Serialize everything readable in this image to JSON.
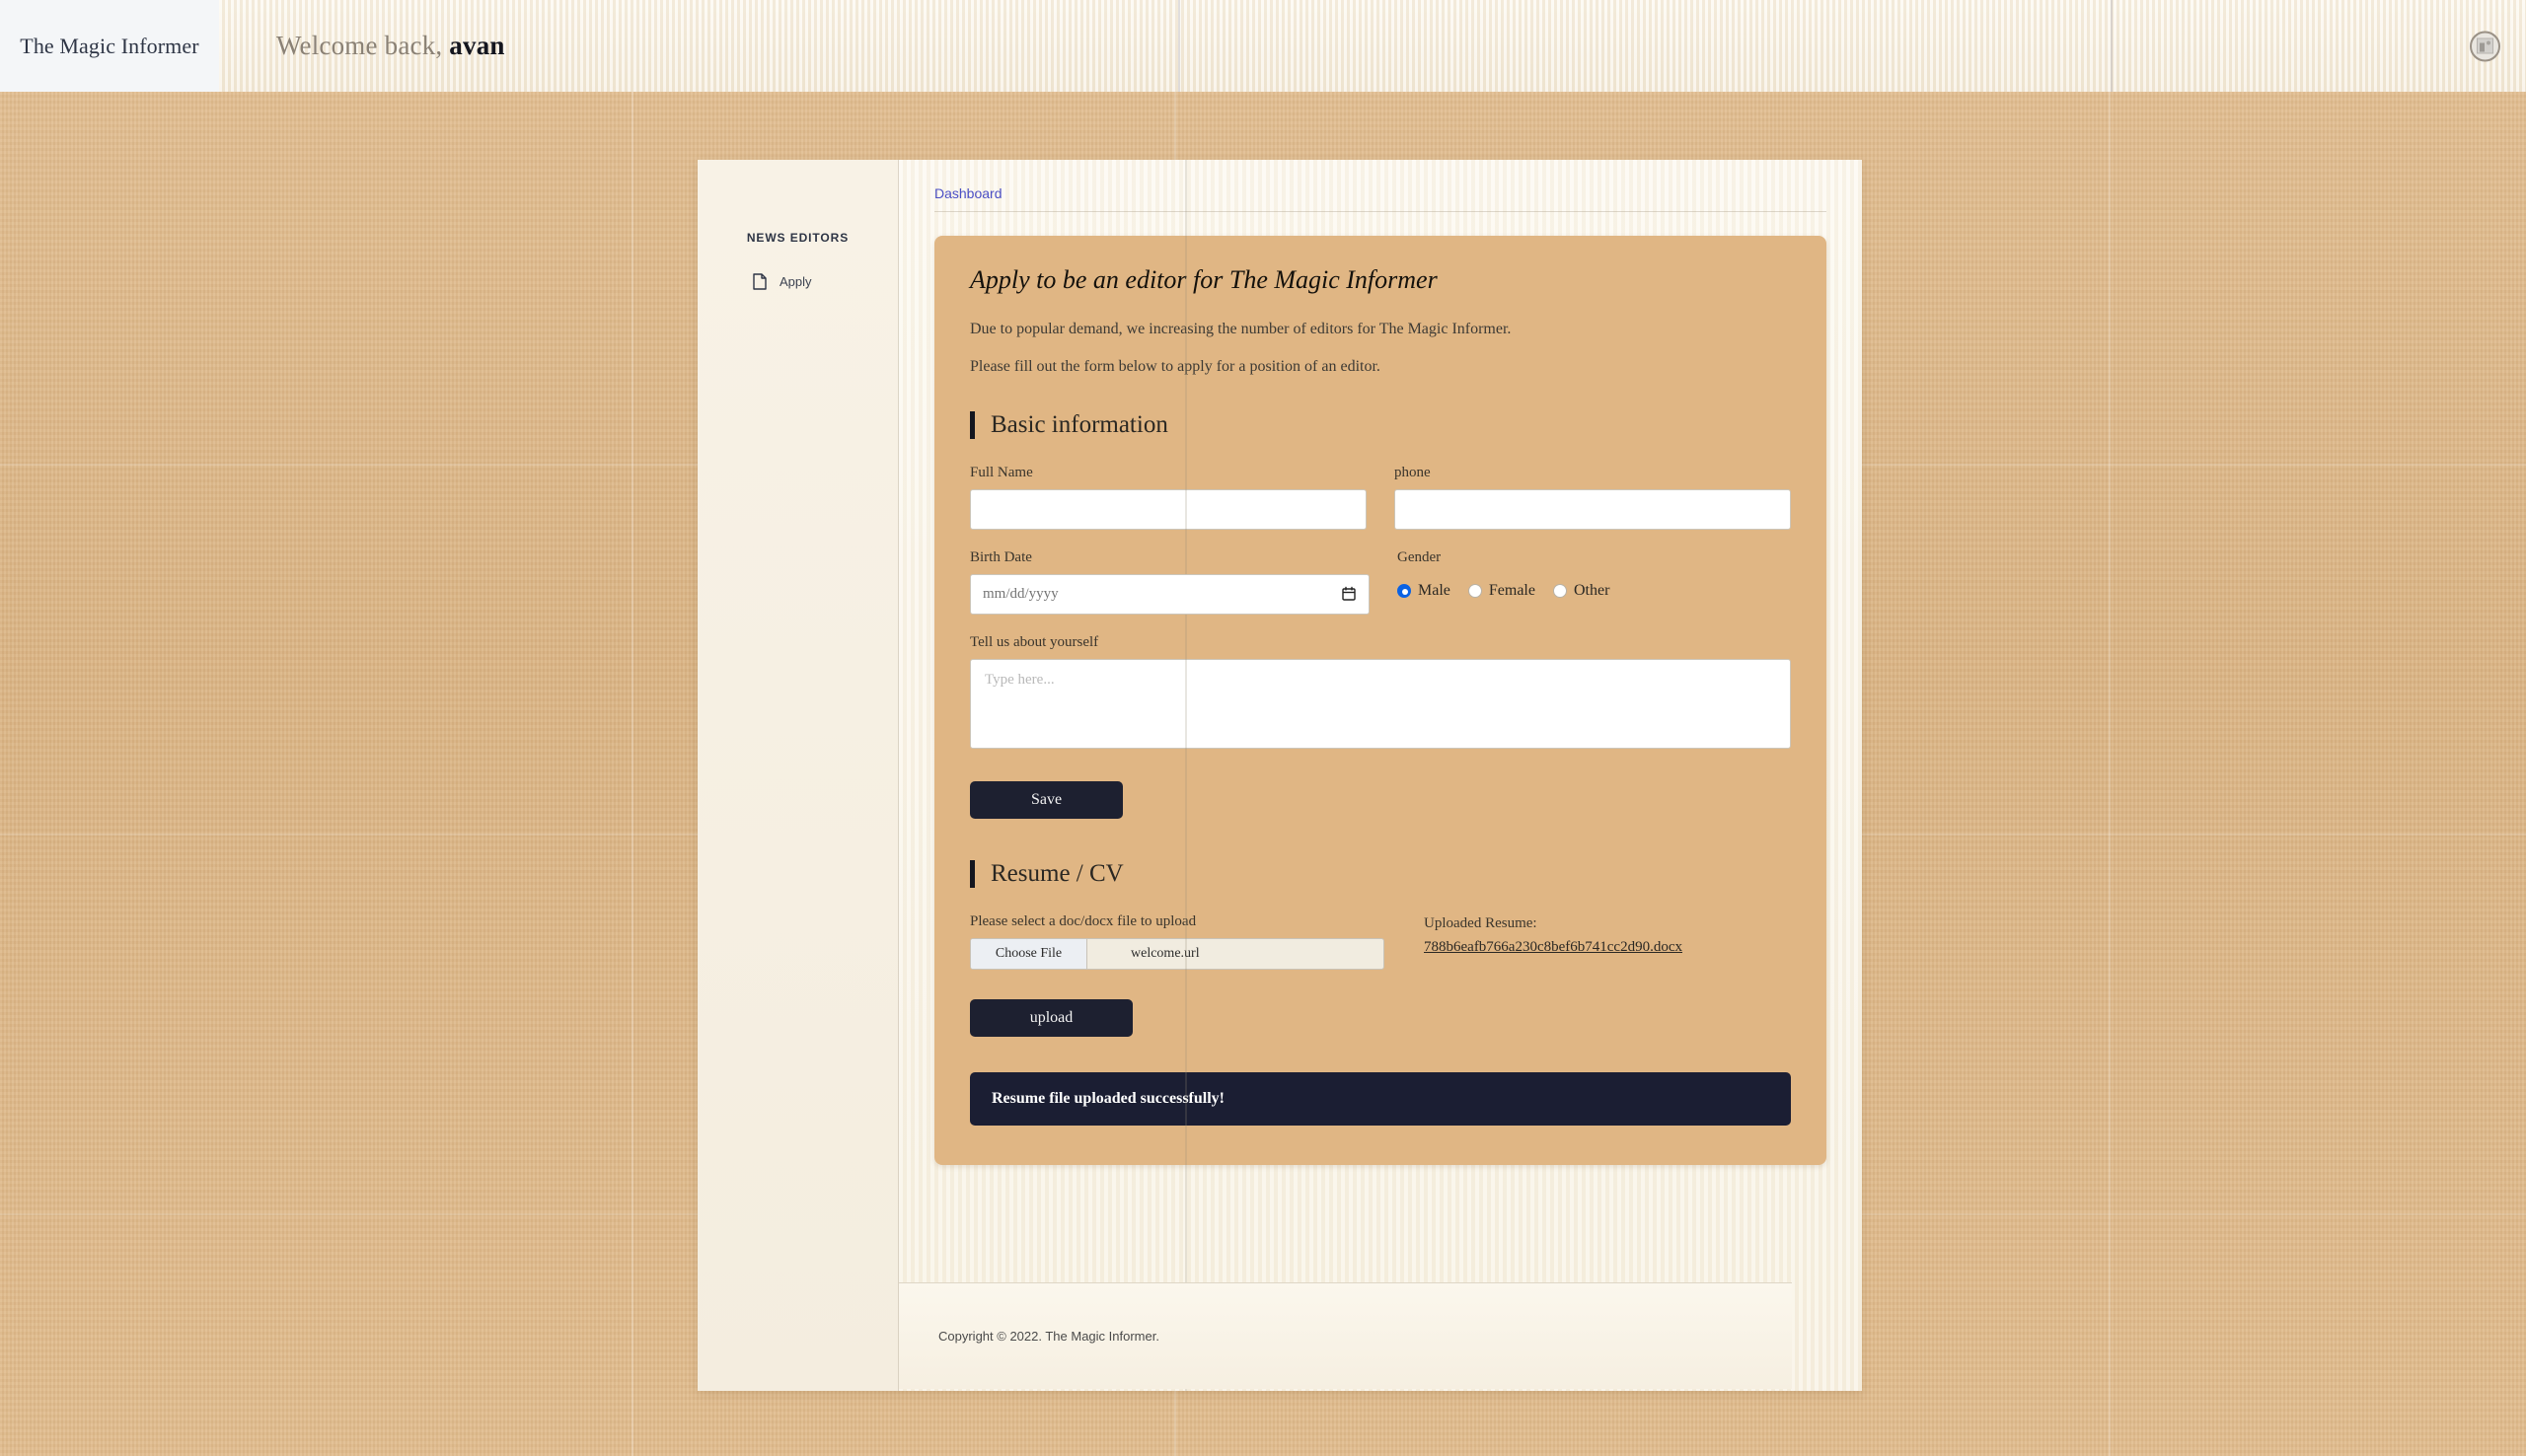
{
  "topbar": {
    "brand": "The Magic Informer",
    "welcome_prefix": "Welcome back, ",
    "welcome_user": "avan",
    "avatar_icon": "broken-image-icon"
  },
  "sidebar": {
    "title": "NEWS EDITORS",
    "items": [
      {
        "label": "Apply",
        "icon": "document-icon"
      }
    ]
  },
  "tabs": [
    {
      "label": "Dashboard"
    }
  ],
  "card": {
    "title": "Apply to be an editor for The Magic Informer",
    "desc_line1": "Due to popular demand, we increasing the number of editors for The Magic Informer.",
    "desc_line2": "Please fill out the form below to apply for a position of an editor.",
    "basic_section": {
      "heading": "Basic information",
      "full_name": {
        "label": "Full Name",
        "value": "",
        "placeholder": ""
      },
      "phone": {
        "label": "phone",
        "value": "",
        "placeholder": ""
      },
      "birth_date": {
        "label": "Birth Date",
        "value": "",
        "placeholder": "mm/dd/yyyy",
        "icon": "calendar-icon"
      },
      "gender": {
        "label": "Gender",
        "options": [
          {
            "label": "Male",
            "checked": true
          },
          {
            "label": "Female",
            "checked": false
          },
          {
            "label": "Other",
            "checked": false
          }
        ]
      },
      "about": {
        "label": "Tell us about yourself",
        "value": "",
        "placeholder": "Type here..."
      },
      "save_label": "Save"
    },
    "resume_section": {
      "heading": "Resume / CV",
      "file_label": "Please select a doc/docx file to upload",
      "choose_file_label": "Choose File",
      "chosen_file": "welcome.url",
      "uploaded_label": "Uploaded Resume:",
      "uploaded_file": "788b6eafb766a230c8bef6b741cc2d90.docx",
      "upload_label": "upload"
    },
    "alert": "Resume file uploaded successfully!"
  },
  "footer": {
    "copyright": "Copyright © 2022. The Magic Informer."
  },
  "colors": {
    "card_bg": "#e0b684",
    "accent_dark": "#14161f",
    "alert_bg": "#1b1e33",
    "link_blue": "#4b4fc4",
    "radio_blue": "#0a62e4",
    "page_bg": "#dfb887"
  }
}
